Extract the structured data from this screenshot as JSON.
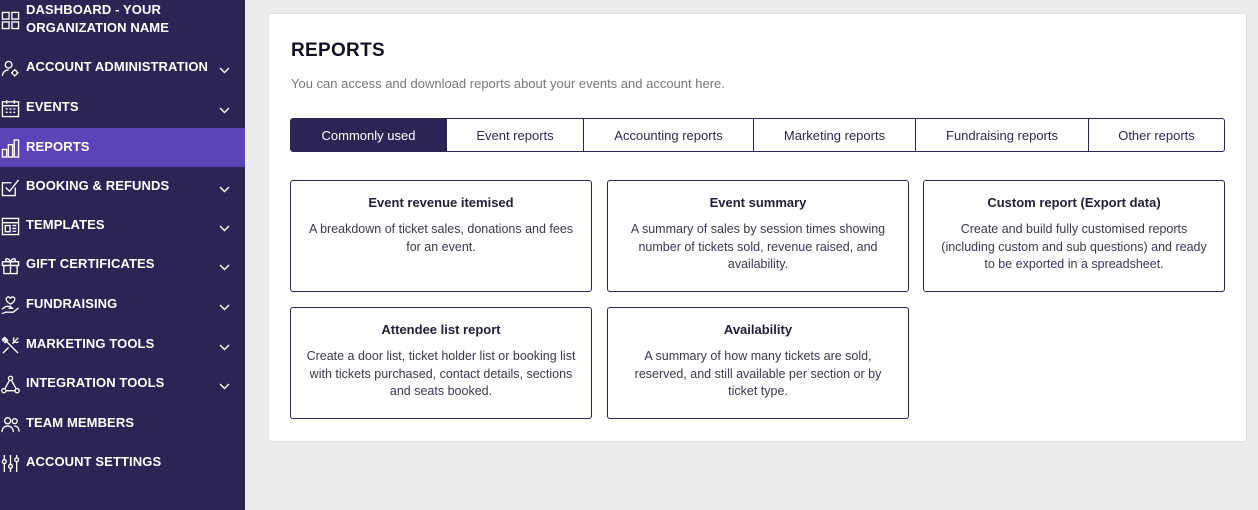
{
  "sidebar": {
    "items": [
      {
        "label": "DASHBOARD - YOUR ORGANIZATION NAME",
        "icon": "dashboard-icon",
        "has_chevron": false
      },
      {
        "label": "ACCOUNT ADMINISTRATION",
        "icon": "user-gear-icon",
        "has_chevron": true
      },
      {
        "label": "EVENTS",
        "icon": "calendar-icon",
        "has_chevron": true
      },
      {
        "label": "REPORTS",
        "icon": "bar-chart-icon",
        "has_chevron": false,
        "active": true
      },
      {
        "label": "BOOKING & REFUNDS",
        "icon": "checkbox-icon",
        "has_chevron": true
      },
      {
        "label": "TEMPLATES",
        "icon": "template-icon",
        "has_chevron": true
      },
      {
        "label": "GIFT CERTIFICATES",
        "icon": "gift-icon",
        "has_chevron": true
      },
      {
        "label": "FUNDRAISING",
        "icon": "hand-heart-icon",
        "has_chevron": true
      },
      {
        "label": "MARKETING TOOLS",
        "icon": "tools-icon",
        "has_chevron": true
      },
      {
        "label": "INTEGRATION TOOLS",
        "icon": "network-icon",
        "has_chevron": true
      },
      {
        "label": "TEAM MEMBERS",
        "icon": "team-icon",
        "has_chevron": false
      },
      {
        "label": "ACCOUNT SETTINGS",
        "icon": "sliders-icon",
        "has_chevron": false
      }
    ]
  },
  "main": {
    "title": "REPORTS",
    "subtitle": "You can access and download reports about your events and account here.",
    "tabs": [
      {
        "label": "Commonly used",
        "active": true
      },
      {
        "label": "Event reports"
      },
      {
        "label": "Accounting reports"
      },
      {
        "label": "Marketing reports"
      },
      {
        "label": "Fundraising reports"
      },
      {
        "label": "Other reports"
      }
    ],
    "cards": [
      {
        "title": "Event revenue itemised",
        "description": "A breakdown of ticket sales, donations and fees for an event."
      },
      {
        "title": "Event summary",
        "description": "A summary of sales by session times showing number of tickets sold, revenue raised, and availability."
      },
      {
        "title": "Custom report (Export data)",
        "description": "Create and build fully customised reports (including custom and sub questions) and ready to be exported in a spreadsheet."
      },
      {
        "title": "Attendee list report",
        "description": "Create a door list, ticket holder list or booking list with tickets purchased, contact details, sections and seats booked."
      },
      {
        "title": "Availability",
        "description": "A summary of how many tickets are sold, reserved, and still available per section or by ticket type."
      }
    ]
  },
  "colors": {
    "sidebar_bg": "#2c2553",
    "sidebar_active": "#5b43b8",
    "page_bg": "#ececec",
    "accent": "#2c2553"
  }
}
